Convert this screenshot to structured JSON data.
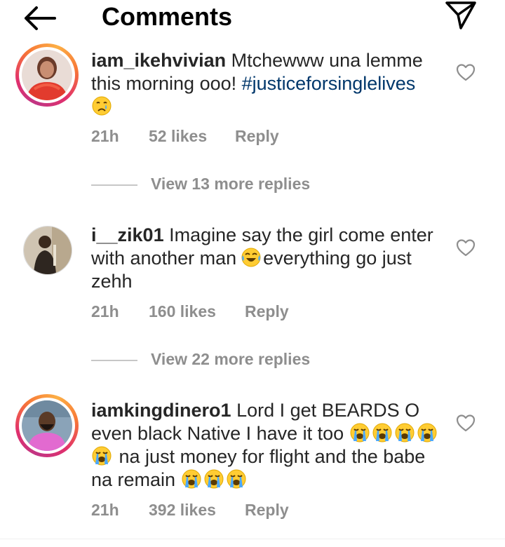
{
  "header": {
    "title": "Comments",
    "back_icon": "arrow-left-icon",
    "share_icon": "paper-plane-icon"
  },
  "comments": [
    {
      "username": "iam_ikehvivian",
      "text": "Mtchewww una lemme this morning ooo!",
      "hashtag": "#justiceforsinglelives",
      "emoji_after": [
        "crying-face-emoji"
      ],
      "time": "21h",
      "likes": "52 likes",
      "reply": "Reply",
      "view_replies": "View 13 more replies",
      "avatar_ring": "story"
    },
    {
      "username": "i__zik01",
      "text_part1": "Imagine say the girl come enter with another man",
      "emoji_mid": [
        "tears-of-joy-emoji"
      ],
      "text_part2": "everything go just zehh",
      "time": "21h",
      "likes": "160 likes",
      "reply": "Reply",
      "view_replies": "View 22 more replies",
      "avatar_ring": "none"
    },
    {
      "username": "iamkingdinero1",
      "text_part1": "Lord I get BEARDS O even black Native I have it too",
      "emoji_mid": [
        "loudly-crying-emoji",
        "loudly-crying-emoji",
        "loudly-crying-emoji",
        "loudly-crying-emoji",
        "loudly-crying-emoji"
      ],
      "text_part2": "na just money for flight and the babe na remain",
      "emoji_end": [
        "loudly-crying-emoji",
        "loudly-crying-emoji",
        "loudly-crying-emoji"
      ],
      "time": "21h",
      "likes": "392 likes",
      "reply": "Reply",
      "avatar_ring": "story"
    }
  ],
  "colors": {
    "text": "#262626",
    "muted": "#8e8e8e",
    "hashtag": "#00376b",
    "story_ring": "#e1306c"
  }
}
